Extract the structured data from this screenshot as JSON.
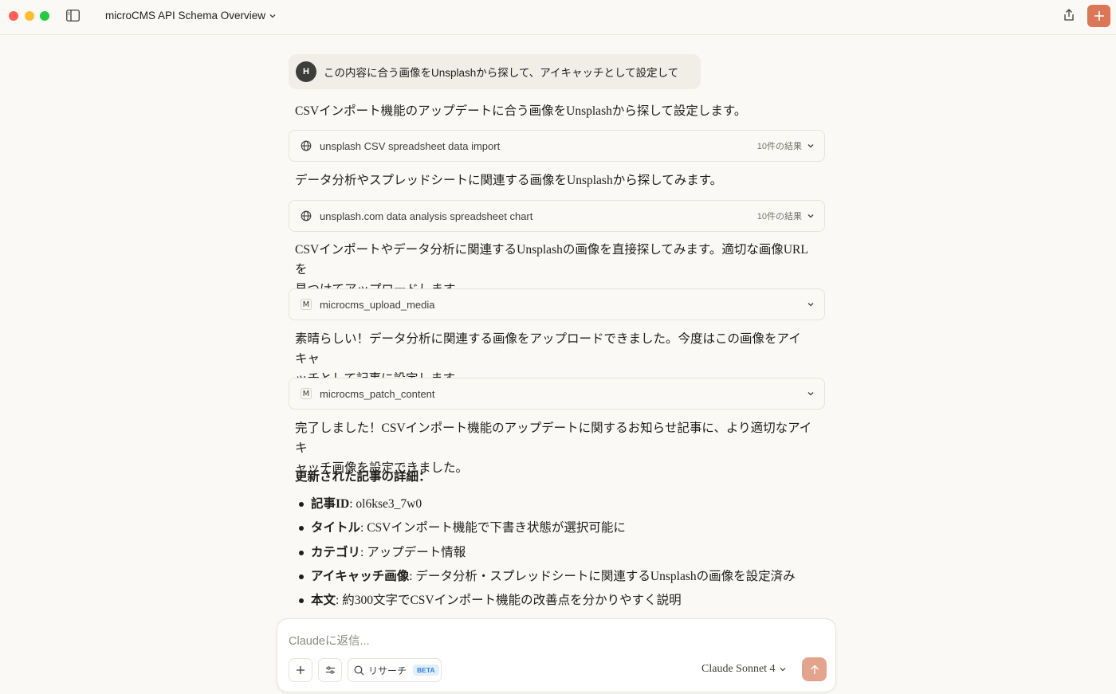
{
  "window": {
    "title": "microCMS API Schema Overview"
  },
  "conversation": {
    "user_avatar": "H",
    "user_message": "この内容に合う画像をUnsplashから探して、アイキャッチとして設定して",
    "para1": "CSVインポート機能のアップデートに合う画像をUnsplashから探して設定します。",
    "tool1": {
      "label": "unsplash CSV spreadsheet data import",
      "count": "10件の結果"
    },
    "para2": "データ分析やスプレッドシートに関連する画像をUnsplashから探してみます。",
    "tool2": {
      "label": "unsplash.com data analysis spreadsheet chart",
      "count": "10件の結果"
    },
    "para3_line1": "CSVインポートやデータ分析に関連するUnsplashの画像を直接探してみます。適切な画像URLを",
    "para3_line2": "見つけてアップロードします。",
    "tool3": {
      "icon_letter": "M",
      "label": "microcms_upload_media"
    },
    "para4_line1": "素晴らしい！データ分析に関連する画像をアップロードできました。今度はこの画像をアイキャ",
    "para4_line2": "ッチとして記事に設定します。",
    "tool4": {
      "icon_letter": "M",
      "label": "microcms_patch_content"
    },
    "para5_line1": "完了しました！CSVインポート機能のアップデートに関するお知らせ記事に、より適切なアイキ",
    "para5_line2": "ャッチ画像を設定できました。",
    "details_heading": "更新された記事の詳細：",
    "details": [
      {
        "label": "記事ID",
        "value": ": ol6kse3_7w0"
      },
      {
        "label": "タイトル",
        "value": ": CSVインポート機能で下書き状態が選択可能に"
      },
      {
        "label": "カテゴリ",
        "value": ": アップデート情報"
      },
      {
        "label": "アイキャッチ画像",
        "value": ": データ分析・スプレッドシートに関連するUnsplashの画像を設定済み"
      },
      {
        "label": "本文",
        "value": ": 約300文字でCSVインポート機能の改善点を分かりやすく説明"
      }
    ]
  },
  "composer": {
    "placeholder": "Claudeに返信...",
    "research_label": "リサーチ",
    "beta_badge": "BETA",
    "model_name": "Claude Sonnet 4"
  },
  "colors": {
    "accent": "#d97757",
    "send_disabled": "#e2a48d",
    "background": "#faf9f5",
    "user_bubble": "#f0eee6"
  }
}
